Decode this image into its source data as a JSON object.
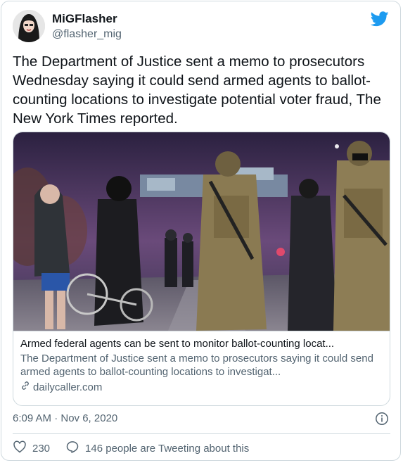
{
  "user": {
    "name": "MiGFlasher",
    "handle": "@flasher_mig"
  },
  "tweet": {
    "text": "The Department of Justice sent a memo to prosecutors Wednesday saying it could send armed agents to ballot-counting locations to investigate potential voter fraud, The New York Times reported.",
    "timestamp": "6:09 AM · Nov 6, 2020"
  },
  "card": {
    "title": "Armed federal agents can be sent to monitor ballot-counting locat...",
    "description": "The Department of Justice sent a memo to prosecutors saying it could send armed agents to ballot-counting locations to investigat...",
    "domain": "dailycaller.com"
  },
  "actions": {
    "likes": "230",
    "tweeting": "146 people are Tweeting about this"
  },
  "colors": {
    "twitter_blue": "#1d9bf0",
    "like_red": "#e0245e",
    "secondary_text": "#536471",
    "border": "#cfd9de"
  },
  "icons": [
    "twitter-bird-icon",
    "link-icon",
    "info-icon",
    "heart-icon",
    "reply-bubble-icon"
  ]
}
